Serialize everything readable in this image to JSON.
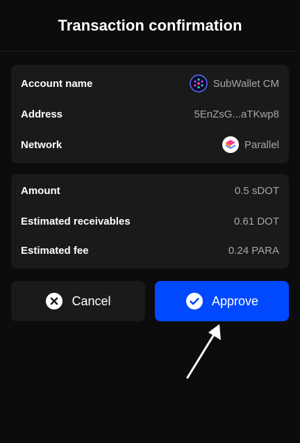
{
  "header": {
    "title": "Transaction confirmation"
  },
  "info": {
    "account_label": "Account name",
    "account_value": "SubWallet CM",
    "address_label": "Address",
    "address_value": "5EnZsG...aTKwp8",
    "network_label": "Network",
    "network_value": "Parallel"
  },
  "amounts": {
    "amount_label": "Amount",
    "amount_value": "0.5 sDOT",
    "receivables_label": "Estimated receivables",
    "receivables_value": "0.61 DOT",
    "fee_label": "Estimated fee",
    "fee_value": "0.24 PARA"
  },
  "actions": {
    "cancel_label": "Cancel",
    "approve_label": "Approve"
  },
  "icons": {
    "account": "subwallet-avatar-icon",
    "network": "parallel-logo-icon",
    "cancel": "close-circle-icon",
    "approve": "check-circle-icon",
    "pointer": "arrow-pointer-icon"
  },
  "colors": {
    "background": "#0c0c0c",
    "card": "#1a1a1a",
    "accent": "#0049ff",
    "muted_text": "#a7a7a7"
  }
}
